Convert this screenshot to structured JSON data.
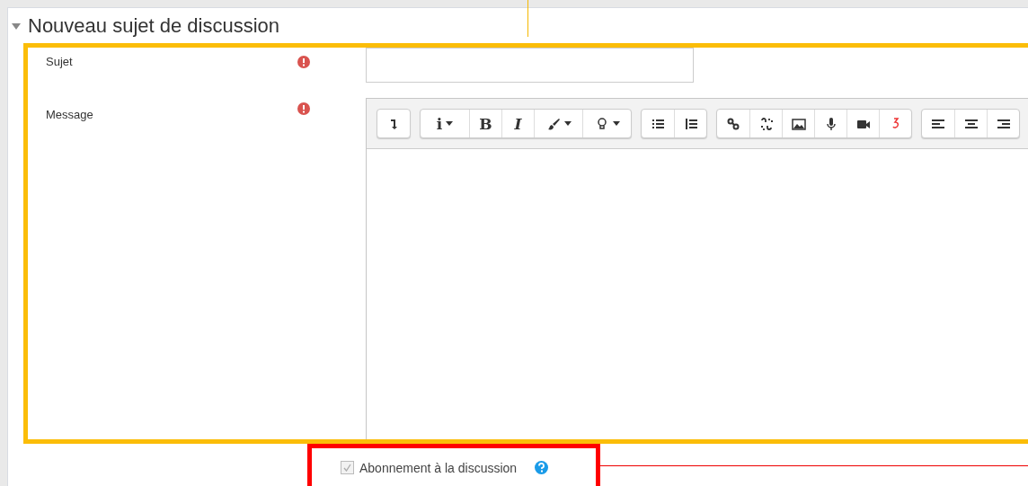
{
  "section": {
    "title": "Nouveau sujet de discussion",
    "expanded": true
  },
  "fields": [
    {
      "label": "Sujet",
      "required": true,
      "kind": "input"
    },
    {
      "label": "Message",
      "required": true,
      "kind": "editor"
    }
  ],
  "toolbar": [
    [
      {
        "kind": "icon",
        "dropdown": false
      }
    ],
    [
      {
        "kind": "text",
        "label": "i",
        "dropdown": true
      },
      {
        "kind": "text",
        "label": "B",
        "dropdown": false
      },
      {
        "kind": "text",
        "label": "I",
        "italic": true,
        "dropdown": false
      },
      {
        "kind": "icon",
        "dropdown": true
      },
      {
        "kind": "icon",
        "dropdown": true
      }
    ],
    [
      {
        "kind": "icon",
        "dropdown": false
      },
      {
        "kind": "icon",
        "dropdown": false
      }
    ],
    [
      {
        "kind": "icon",
        "dropdown": false
      },
      {
        "kind": "icon",
        "dropdown": false
      },
      {
        "kind": "icon",
        "dropdown": false
      },
      {
        "kind": "icon",
        "dropdown": false
      },
      {
        "kind": "icon",
        "dropdown": false
      },
      {
        "kind": "icon",
        "dropdown": false
      }
    ],
    [
      {
        "kind": "icon",
        "dropdown": false
      },
      {
        "kind": "icon",
        "dropdown": false
      },
      {
        "kind": "icon",
        "dropdown": false
      }
    ]
  ],
  "subscription": {
    "label": "Abonnement à la discussion",
    "checked": true,
    "disabled": true
  }
}
